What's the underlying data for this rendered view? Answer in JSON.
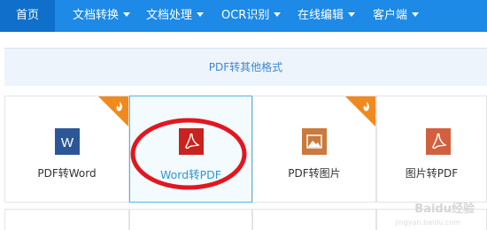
{
  "nav": {
    "items": [
      {
        "label": "首页",
        "active": true,
        "has_caret": false
      },
      {
        "label": "文档转换",
        "active": false,
        "has_caret": true
      },
      {
        "label": "文档处理",
        "active": false,
        "has_caret": true
      },
      {
        "label": "OCR识别",
        "active": false,
        "has_caret": true
      },
      {
        "label": "在线编辑",
        "active": false,
        "has_caret": true
      },
      {
        "label": "客户端",
        "active": false,
        "has_caret": true
      }
    ]
  },
  "banner": {
    "text": "PDF转其他格式"
  },
  "cards": [
    {
      "label": "PDF转Word",
      "icon": "word-icon",
      "hot": true,
      "selected": false
    },
    {
      "label": "Word转PDF",
      "icon": "pdf-icon",
      "hot": false,
      "selected": true
    },
    {
      "label": "PDF转图片",
      "icon": "image-icon",
      "hot": true,
      "selected": false
    },
    {
      "label": "图片转PDF",
      "icon": "pdf-icon",
      "hot": false,
      "selected": false
    }
  ],
  "watermark": {
    "text": "Baidu经验",
    "sub": "jingyan.baidu.com"
  },
  "colors": {
    "nav_bg": "#1c8ae6",
    "nav_active": "#0f6fcb",
    "accent_text": "#3a87d6",
    "word_icon": "#2b5797",
    "pdf_icon": "#c8231f",
    "image_icon": "#c97a3c",
    "pdf2_icon": "#d2603f",
    "hot_badge": "#f08a1e",
    "highlight_circle": "#e3161f"
  }
}
